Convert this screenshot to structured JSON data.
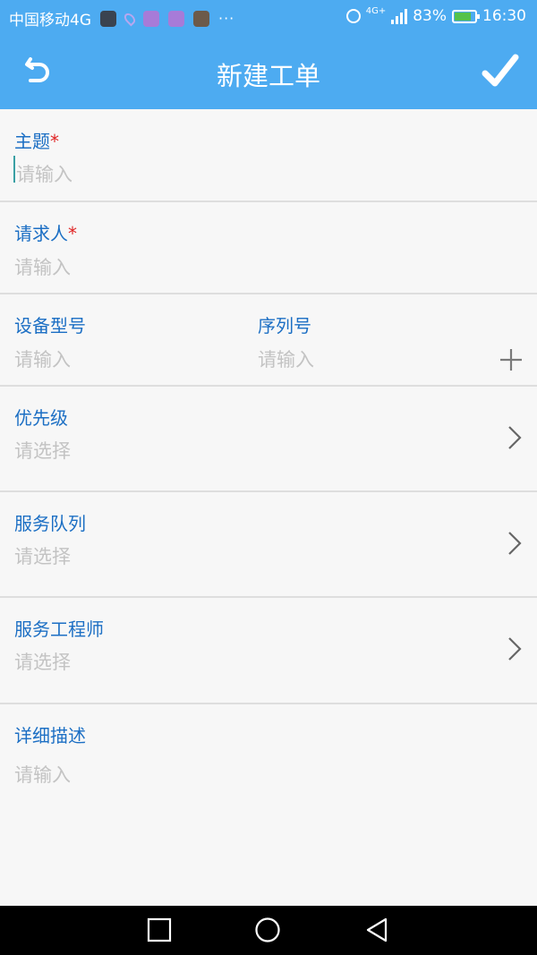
{
  "status_bar": {
    "carrier": "中国移动4G",
    "network": "4G+",
    "battery_percent": "83%",
    "battery_level": 0.83,
    "time": "16:30",
    "battery_color": "#55c24a"
  },
  "header": {
    "title": "新建工单",
    "back_icon": "undo-arrow-icon",
    "confirm_icon": "checkmark-icon",
    "background_color": "#4dabf1"
  },
  "form": {
    "subject": {
      "label": "主题",
      "required_mark": "*",
      "placeholder": "请输入"
    },
    "requester": {
      "label": "请求人",
      "required_mark": "*",
      "placeholder": "请输入"
    },
    "device_model": {
      "label": "设备型号",
      "placeholder": "请输入"
    },
    "serial_number": {
      "label": "序列号",
      "placeholder": "请输入"
    },
    "priority": {
      "label": "优先级",
      "placeholder": "请选择"
    },
    "service_queue": {
      "label": "服务队列",
      "placeholder": "请选择"
    },
    "service_engineer": {
      "label": "服务工程师",
      "placeholder": "请选择"
    },
    "description": {
      "label": "详细描述",
      "placeholder": "请输入"
    }
  },
  "colors": {
    "label": "#1c6fc4",
    "placeholder": "#c3c3c3",
    "required": "#e02424"
  }
}
